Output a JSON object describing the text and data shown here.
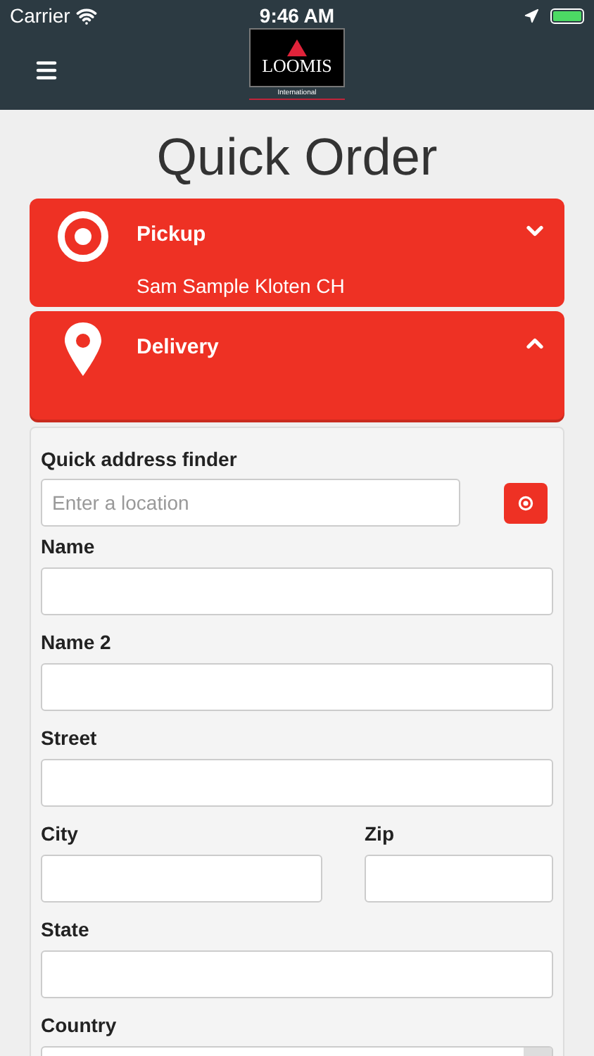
{
  "status_bar": {
    "carrier": "Carrier",
    "time": "9:46 AM"
  },
  "header": {
    "logo_text": "LOOMIS",
    "logo_subtext": "International"
  },
  "title": "Quick Order",
  "sections": [
    {
      "kind": "pickup",
      "title": "Pickup",
      "subtitle": "Sam Sample Kloten CH",
      "expanded": false
    },
    {
      "kind": "delivery",
      "title": "Delivery",
      "expanded": true
    }
  ],
  "form": {
    "finder": {
      "label": "Quick address finder",
      "placeholder": "Enter a location"
    },
    "rows": [
      [
        {
          "label": "Name",
          "kind": "text"
        }
      ],
      [
        {
          "label": "Name 2",
          "kind": "text"
        }
      ],
      [
        {
          "label": "Street",
          "kind": "text"
        }
      ],
      [
        {
          "label": "City",
          "kind": "text"
        },
        {
          "label": "Zip",
          "kind": "text"
        }
      ],
      [
        {
          "label": "State",
          "kind": "text"
        }
      ],
      [
        {
          "label": "Country",
          "kind": "select"
        }
      ]
    ]
  }
}
